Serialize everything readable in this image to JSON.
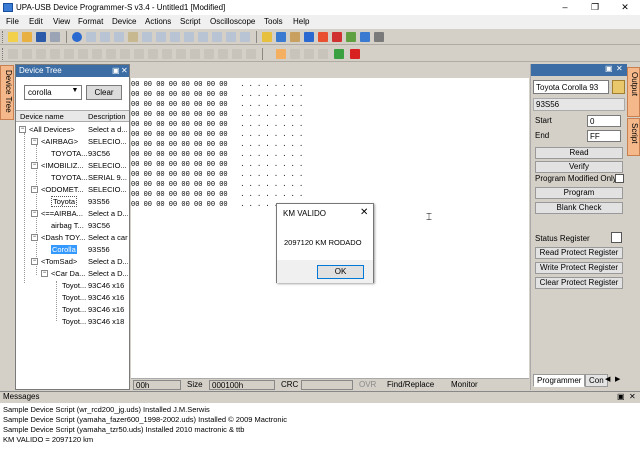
{
  "window": {
    "title": "UPA-USB Device Programmer-S v3.4 - Untitled1 [Modified]",
    "minimize": "–",
    "maximize": "❐",
    "close": "✕"
  },
  "menu": [
    "File",
    "Edit",
    "View",
    "Format",
    "Device",
    "Actions",
    "Script",
    "Oscilloscope",
    "Tools",
    "Help"
  ],
  "device_tree": {
    "side_tab": "Device Tree",
    "header": "Device Tree",
    "filter_value": "corolla",
    "clear_label": "Clear",
    "col_name": "Device name",
    "col_desc": "Description",
    "rows": [
      {
        "name": "<All Devices>",
        "desc": "Select a d..."
      },
      {
        "name": "<AIRBAG>",
        "desc": "SELECIO..."
      },
      {
        "name": "TOYOTA...",
        "desc": "93C56"
      },
      {
        "name": "<IMOBILIZ...",
        "desc": "SELECIO..."
      },
      {
        "name": "TOYOTA...",
        "desc": "SERIAL 9..."
      },
      {
        "name": "<ODOMET...",
        "desc": "SELECIO..."
      },
      {
        "name": "Toyota",
        "desc": "93S56"
      },
      {
        "name": "<==AIRBA...",
        "desc": "Select a D..."
      },
      {
        "name": "airbag T...",
        "desc": "93C56"
      },
      {
        "name": "<Dash TOY...",
        "desc": "Select a car"
      },
      {
        "name": "Corolla",
        "desc": "93S56"
      },
      {
        "name": "<TomSad>",
        "desc": "Select a D..."
      },
      {
        "name": "<Car Da...",
        "desc": "Select a D..."
      },
      {
        "name": "Toyot...",
        "desc": "93C46 x16"
      },
      {
        "name": "Toyot...",
        "desc": "93C46 x16"
      },
      {
        "name": "Toyot...",
        "desc": "93C46 x16"
      },
      {
        "name": "Toyot...",
        "desc": "93C46 x18"
      }
    ]
  },
  "hex": {
    "line": "00 00 00 00 00 00 00 00   . . . . . . . .",
    "status": {
      "addr": "00h",
      "size_label": "Size",
      "size_value": "000100h",
      "crc_label": "CRC",
      "ovr": "OVR",
      "find_replace": "Find/Replace",
      "monitor": "Monitor"
    }
  },
  "right_panel": {
    "device": "Toyota Corolla 93",
    "chip": "93S56",
    "start_label": "Start",
    "start_value": "0",
    "end_label": "End",
    "end_value": "FF",
    "read": "Read",
    "verify": "Verify",
    "program_modified": "Program Modified Only",
    "program": "Program",
    "blank_check": "Blank Check",
    "status_register": "Status Register",
    "read_protect": "Read Protect Register",
    "write_protect": "Write Protect Register",
    "clear_protect": "Clear Protect Register",
    "tab_programmer": "Programmer",
    "tab_con": "Con"
  },
  "side_tabs": {
    "output": "Output",
    "script": "Script"
  },
  "messages": {
    "header": "Messages",
    "lines": [
      "Sample Device Script (wr_rcd200_jg.uds) Installed J.M.Serwis",
      "Sample Device Script (yamaha_fazer600_1998-2002.uds) Installed © 2009 Mactronic",
      "Sample Device Script (yamaha_tzr50.uds) Installed 2010 mactronic & ttb",
      "KM VALIDO = 2097120 km"
    ]
  },
  "dialog": {
    "title": "KM VALIDO",
    "close": "✕",
    "message": "2097120 KM RODADO",
    "ok": "OK"
  },
  "colors": {
    "accent_blue": "#3c6ea5",
    "tab_orange": "#f4b88a",
    "selection": "#3399ff"
  }
}
